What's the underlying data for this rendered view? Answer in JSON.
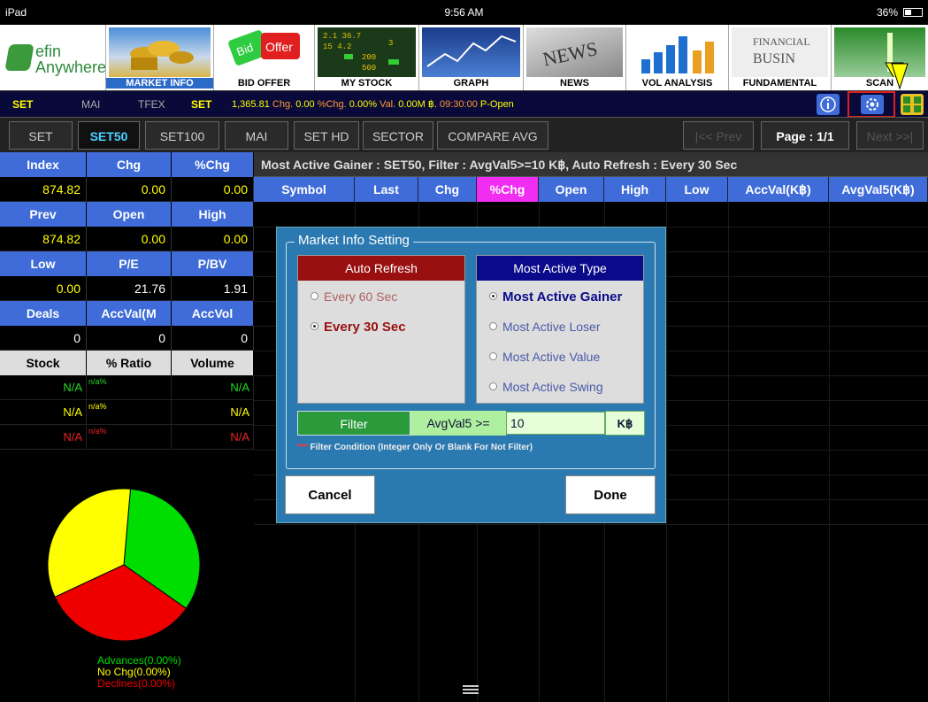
{
  "status_bar": {
    "device": "iPad",
    "time": "9:56 AM",
    "battery": "36%"
  },
  "logo": {
    "line1": "efin",
    "line2": "Anywhere"
  },
  "toolbar": [
    {
      "label": "MARKET INFO",
      "icon": "coins-icon"
    },
    {
      "label": "BID OFFER",
      "icon": "bid-offer-icon"
    },
    {
      "label": "MY STOCK",
      "icon": "stock-board-icon"
    },
    {
      "label": "GRAPH",
      "icon": "graph-icon"
    },
    {
      "label": "NEWS",
      "icon": "newspaper-icon"
    },
    {
      "label": "VOL ANALYSIS",
      "icon": "bar-chart-icon"
    },
    {
      "label": "FUNDAMENTAL",
      "icon": "financial-business-icon"
    },
    {
      "label": "SCAN",
      "icon": "scan-icon"
    }
  ],
  "info_bar": {
    "set": "SET",
    "mai": "MAI",
    "tfex": "TFEX",
    "set2": "SET",
    "index": "1,365.81",
    "chg_label": "Chg.",
    "chg": "0.00",
    "pchg_label": "%Chg.",
    "pchg": "0.00%",
    "val_label": "Val.",
    "val": "0.00M ฿.",
    "time": "09:30:00",
    "state": "P-Open"
  },
  "tabs": [
    "SET",
    "SET50",
    "SET100",
    "MAI",
    "SET HD",
    "SECTOR",
    "COMPARE AVG"
  ],
  "active_tab": "SET50",
  "pager": {
    "prev": "|<< Prev",
    "page": "Page : 1/1",
    "next": "Next >>|"
  },
  "index_panel": {
    "h1": [
      "Index",
      "Chg",
      "%Chg"
    ],
    "v1": [
      "874.82",
      "0.00",
      "0.00"
    ],
    "h2": [
      "Prev",
      "Open",
      "High"
    ],
    "v2": [
      "874.82",
      "0.00",
      "0.00"
    ],
    "h3": [
      "Low",
      "P/E",
      "P/BV"
    ],
    "v3": [
      "0.00",
      "21.76",
      "1.91"
    ],
    "h4": [
      "Deals",
      "AccVal(M",
      "AccVol"
    ],
    "v4": [
      "0",
      "0",
      "0"
    ],
    "h5": [
      "Stock",
      "% Ratio",
      "Volume"
    ],
    "rows": [
      {
        "stock": "N/A",
        "ratio": "n/a%",
        "volume": "N/A"
      },
      {
        "stock": "N/A",
        "ratio": "n/a%",
        "volume": "N/A"
      },
      {
        "stock": "N/A",
        "ratio": "n/a%",
        "volume": "N/A"
      }
    ]
  },
  "pie": {
    "slices": [
      {
        "label": "Advances",
        "value": 33.33,
        "color": "#00dd00"
      },
      {
        "label": "Declines",
        "value": 33.33,
        "color": "#ee0000"
      },
      {
        "label": "No Chg",
        "value": 33.34,
        "color": "#ffff00"
      }
    ]
  },
  "legend": {
    "advances": "Advances(0.00%)",
    "nochg": "No Chg(0.00%)",
    "declines": "Declines(0.00%)"
  },
  "main": {
    "title": "Most Active Gainer : SET50, Filter : AvgVal5>=10 K฿, Auto Refresh : Every 30 Sec",
    "columns": [
      "Symbol",
      "Last",
      "Chg",
      "%Chg",
      "Open",
      "High",
      "Low",
      "AccVal(K฿)",
      "AvgVal5(K฿)"
    ]
  },
  "dialog": {
    "title": "Market Info Setting",
    "auto_refresh": {
      "header": "Auto Refresh",
      "options": [
        "Every 60 Sec",
        "Every 30 Sec"
      ],
      "selected": "Every 30 Sec"
    },
    "most_active": {
      "header": "Most Active Type",
      "options": [
        "Most Active Gainer",
        "Most Active Loser",
        "Most Active Value",
        "Most Active Swing"
      ],
      "selected": "Most Active Gainer"
    },
    "filter": {
      "label": "Filter",
      "key": "AvgVal5 >=",
      "value": "10",
      "unit": "K฿"
    },
    "note_star": "***",
    "note": "Filter Condition (Integer Only Or Blank For Not Filter)",
    "cancel": "Cancel",
    "done": "Done"
  }
}
